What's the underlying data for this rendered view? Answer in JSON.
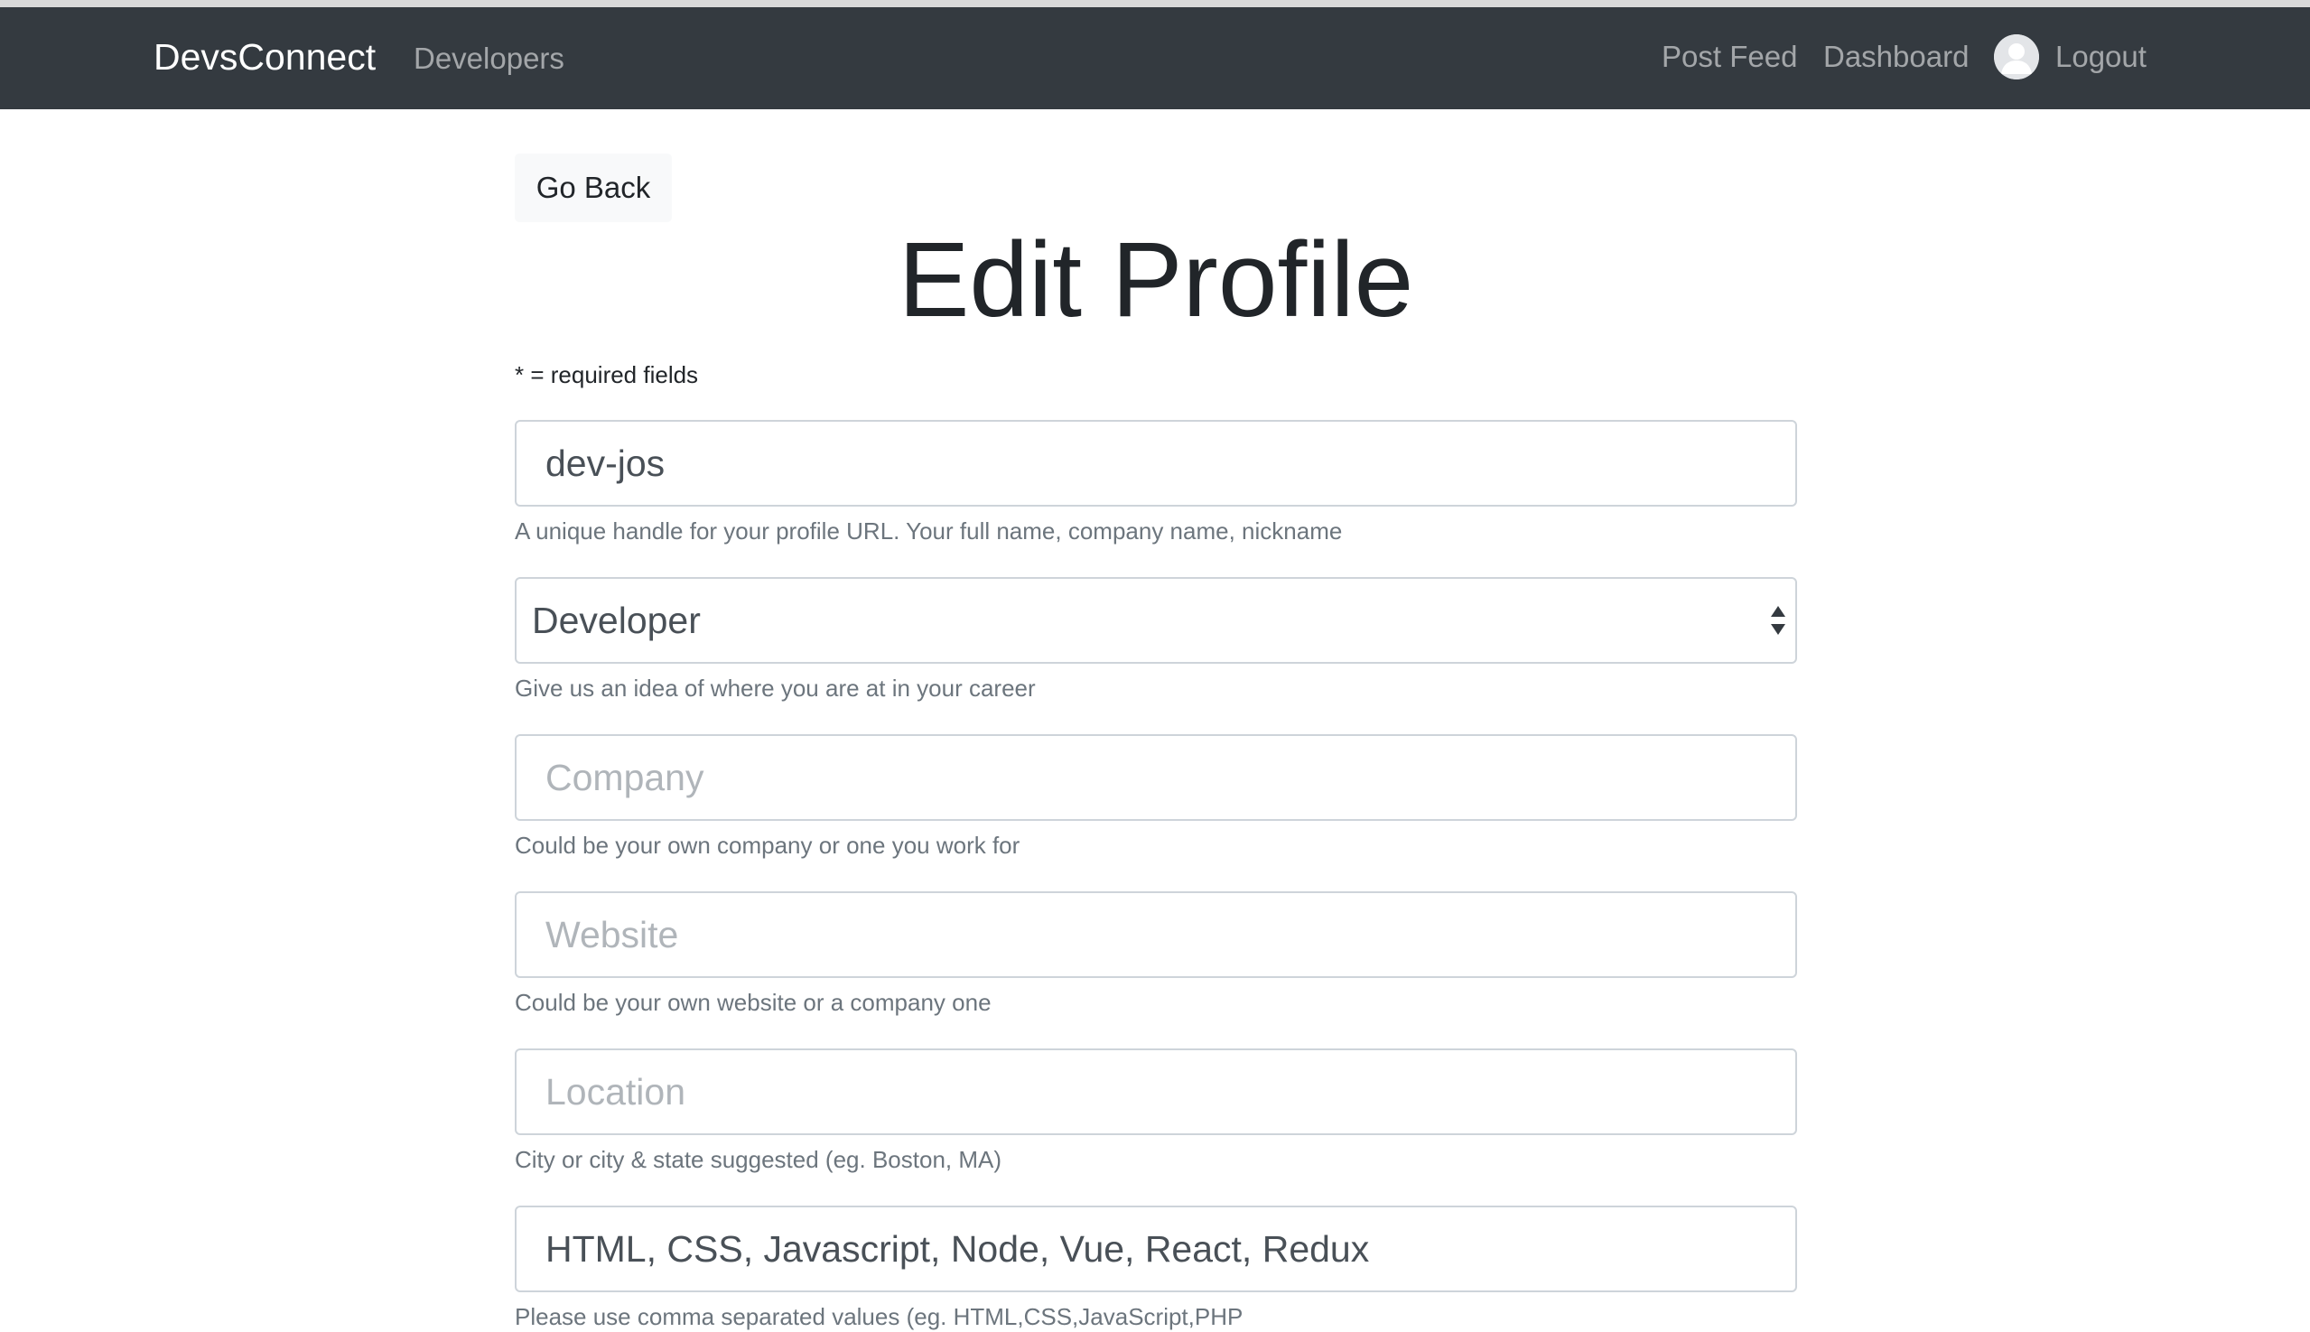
{
  "navbar": {
    "brand": "DevsConnect",
    "links": {
      "developers": "Developers",
      "post_feed": "Post Feed",
      "dashboard": "Dashboard",
      "logout": "Logout"
    },
    "avatar_icon": "user-avatar-icon",
    "background": "#343a40"
  },
  "page": {
    "go_back_label": "Go Back",
    "title": "Edit Profile",
    "required_note": "* = required fields"
  },
  "form": {
    "handle": {
      "value": "dev-jos",
      "help": "A unique handle for your profile URL. Your full name, company name, nickname"
    },
    "status": {
      "selected": "Developer",
      "help": "Give us an idea of where you are at in your career"
    },
    "company": {
      "value": "",
      "placeholder": "Company",
      "help": "Could be your own company or one you work for"
    },
    "website": {
      "value": "",
      "placeholder": "Website",
      "help": "Could be your own website or a company one"
    },
    "location": {
      "value": "",
      "placeholder": "Location",
      "help": "City or city & state suggested (eg. Boston, MA)"
    },
    "skills": {
      "value": "HTML, CSS, Javascript, Node, Vue, React, Redux",
      "help": "Please use comma separated values (eg. HTML,CSS,JavaScript,PHP"
    }
  }
}
